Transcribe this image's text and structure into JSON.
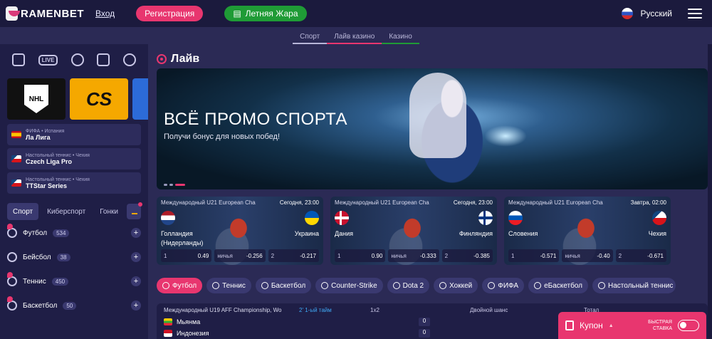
{
  "header": {
    "logo": "RAMENBET",
    "login": "Вход",
    "register": "Регистрация",
    "promo": "Летняя Жара",
    "language": "Русский"
  },
  "subnav": {
    "tabs": [
      "Спорт",
      "Лайв казино",
      "Казино"
    ]
  },
  "sidebar": {
    "tiles": [
      "NHL",
      "CS"
    ],
    "matches": [
      {
        "sub": "ФИФА • Испания",
        "title": "Ла Лига"
      },
      {
        "sub": "Настольный теннис • Чехия",
        "title": "Czech Liga Pro"
      },
      {
        "sub": "Настольный теннис • Чехия",
        "title": "TTStar Series"
      }
    ],
    "tabs": [
      "Спорт",
      "Киберспорт",
      "Гонки"
    ],
    "sports": [
      {
        "label": "Футбол",
        "count": "534"
      },
      {
        "label": "Бейсбол",
        "count": "38"
      },
      {
        "label": "Теннис",
        "count": "450"
      },
      {
        "label": "Баскетбол",
        "count": "50"
      }
    ]
  },
  "main": {
    "live_title": "Лайв",
    "banner": {
      "title": "ВСЁ ПРОМО СПОРТА",
      "subtitle": "Получи бонус для новых побед!"
    },
    "games": [
      {
        "league": "Международный U21 European Cha",
        "time": "Сегодня, 23:00",
        "team1": "Голландия (Нидерланды)",
        "team2": "Украина",
        "odds": [
          {
            "k": "1",
            "v": "0.49"
          },
          {
            "k": "ничья",
            "v": "-0.256"
          },
          {
            "k": "2",
            "v": "-0.217"
          }
        ]
      },
      {
        "league": "Международный U21 European Cha",
        "time": "Сегодня, 23:00",
        "team1": "Дания",
        "team2": "Финляндия",
        "odds": [
          {
            "k": "1",
            "v": "0.90"
          },
          {
            "k": "ничья",
            "v": "-0.333"
          },
          {
            "k": "2",
            "v": "-0.385"
          }
        ]
      },
      {
        "league": "Международный U21 European Cha",
        "time": "Завтра, 02:00",
        "team1": "Словения",
        "team2": "Чехия",
        "odds": [
          {
            "k": "1",
            "v": "-0.571"
          },
          {
            "k": "ничья",
            "v": "-0.40"
          },
          {
            "k": "2",
            "v": "-0.671"
          }
        ]
      }
    ],
    "chips": [
      "Футбол",
      "Теннис",
      "Баскетбол",
      "Counter-Strike",
      "Dota 2",
      "Хоккей",
      "ФИФА",
      "еБаскетбол",
      "Настольный теннис"
    ],
    "table": {
      "league": "Международный U19 AFF Championship, Wo",
      "status": "2' 1-ый тайм",
      "col1": "1x2",
      "col2": "Двойной шанс",
      "col3": "Тотал",
      "rows": [
        {
          "team": "Мьянма",
          "score": "0"
        },
        {
          "team": "Индонезия",
          "score": "0"
        }
      ]
    }
  },
  "coupon": {
    "label": "Купон",
    "fast_line1": "БЫСТРАЯ",
    "fast_line2": "СТАВКА"
  },
  "colors": {
    "accent_pink": "#e8366f",
    "accent_green": "#1f9b36",
    "bg_dark": "#1b1a3d",
    "bg_main": "#2b2a55"
  }
}
